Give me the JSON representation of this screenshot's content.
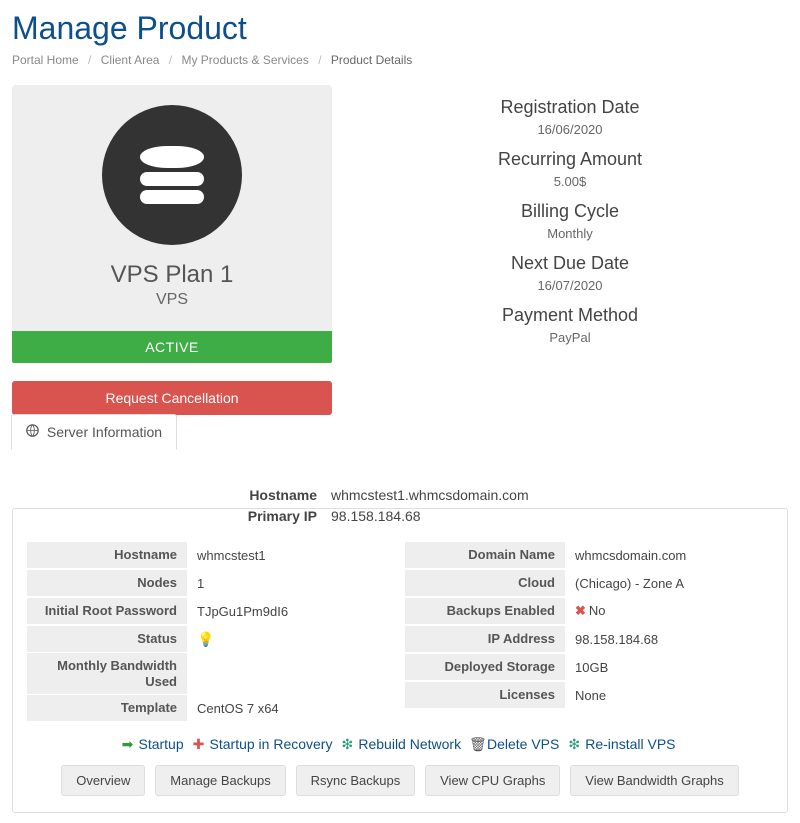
{
  "title": "Manage Product",
  "breadcrumb": {
    "home": "Portal Home",
    "client": "Client Area",
    "products": "My Products & Services",
    "current": "Product Details"
  },
  "product": {
    "name": "VPS Plan 1",
    "category": "VPS",
    "status": "ACTIVE",
    "cancel_label": "Request Cancellation"
  },
  "billing": {
    "reg_date_lbl": "Registration Date",
    "reg_date": "16/06/2020",
    "recur_lbl": "Recurring Amount",
    "recur": "5.00$",
    "cycle_lbl": "Billing Cycle",
    "cycle": "Monthly",
    "due_lbl": "Next Due Date",
    "due": "16/07/2020",
    "method_lbl": "Payment Method",
    "method": "PayPal"
  },
  "tab": {
    "label": "Server Information"
  },
  "head": {
    "host_lbl": "Hostname",
    "host": "whmcstest1.whmcsdomain.com",
    "ip_lbl": "Primary IP",
    "ip": "98.158.184.68"
  },
  "left": {
    "hostname_lbl": "Hostname",
    "hostname": "whmcstest1",
    "nodes_lbl": "Nodes",
    "nodes": "1",
    "rootpw_lbl": "Initial Root Password",
    "rootpw": "TJpGu1Pm9dI6",
    "status_lbl": "Status",
    "bw_lbl": "Monthly Bandwidth Used",
    "bw": "",
    "tpl_lbl": "Template",
    "tpl": "CentOS 7 x64"
  },
  "right": {
    "domain_lbl": "Domain Name",
    "domain": "whmcsdomain.com",
    "cloud_lbl": "Cloud",
    "cloud": "(Chicago) - Zone A",
    "backups_lbl": "Backups Enabled",
    "backups": "No",
    "ip_lbl": "IP Address",
    "ip": "98.158.184.68",
    "storage_lbl": "Deployed Storage",
    "storage": "10GB",
    "lic_lbl": "Licenses",
    "lic": "None"
  },
  "actions": {
    "startup": "Startup",
    "recovery": "Startup in Recovery",
    "rebuild": "Rebuild Network",
    "delete": "Delete VPS",
    "reinstall": "Re-install VPS"
  },
  "buttons": {
    "overview": "Overview",
    "manage_backups": "Manage Backups",
    "rsync": "Rsync Backups",
    "cpu": "View CPU Graphs",
    "bw": "View Bandwidth Graphs"
  }
}
